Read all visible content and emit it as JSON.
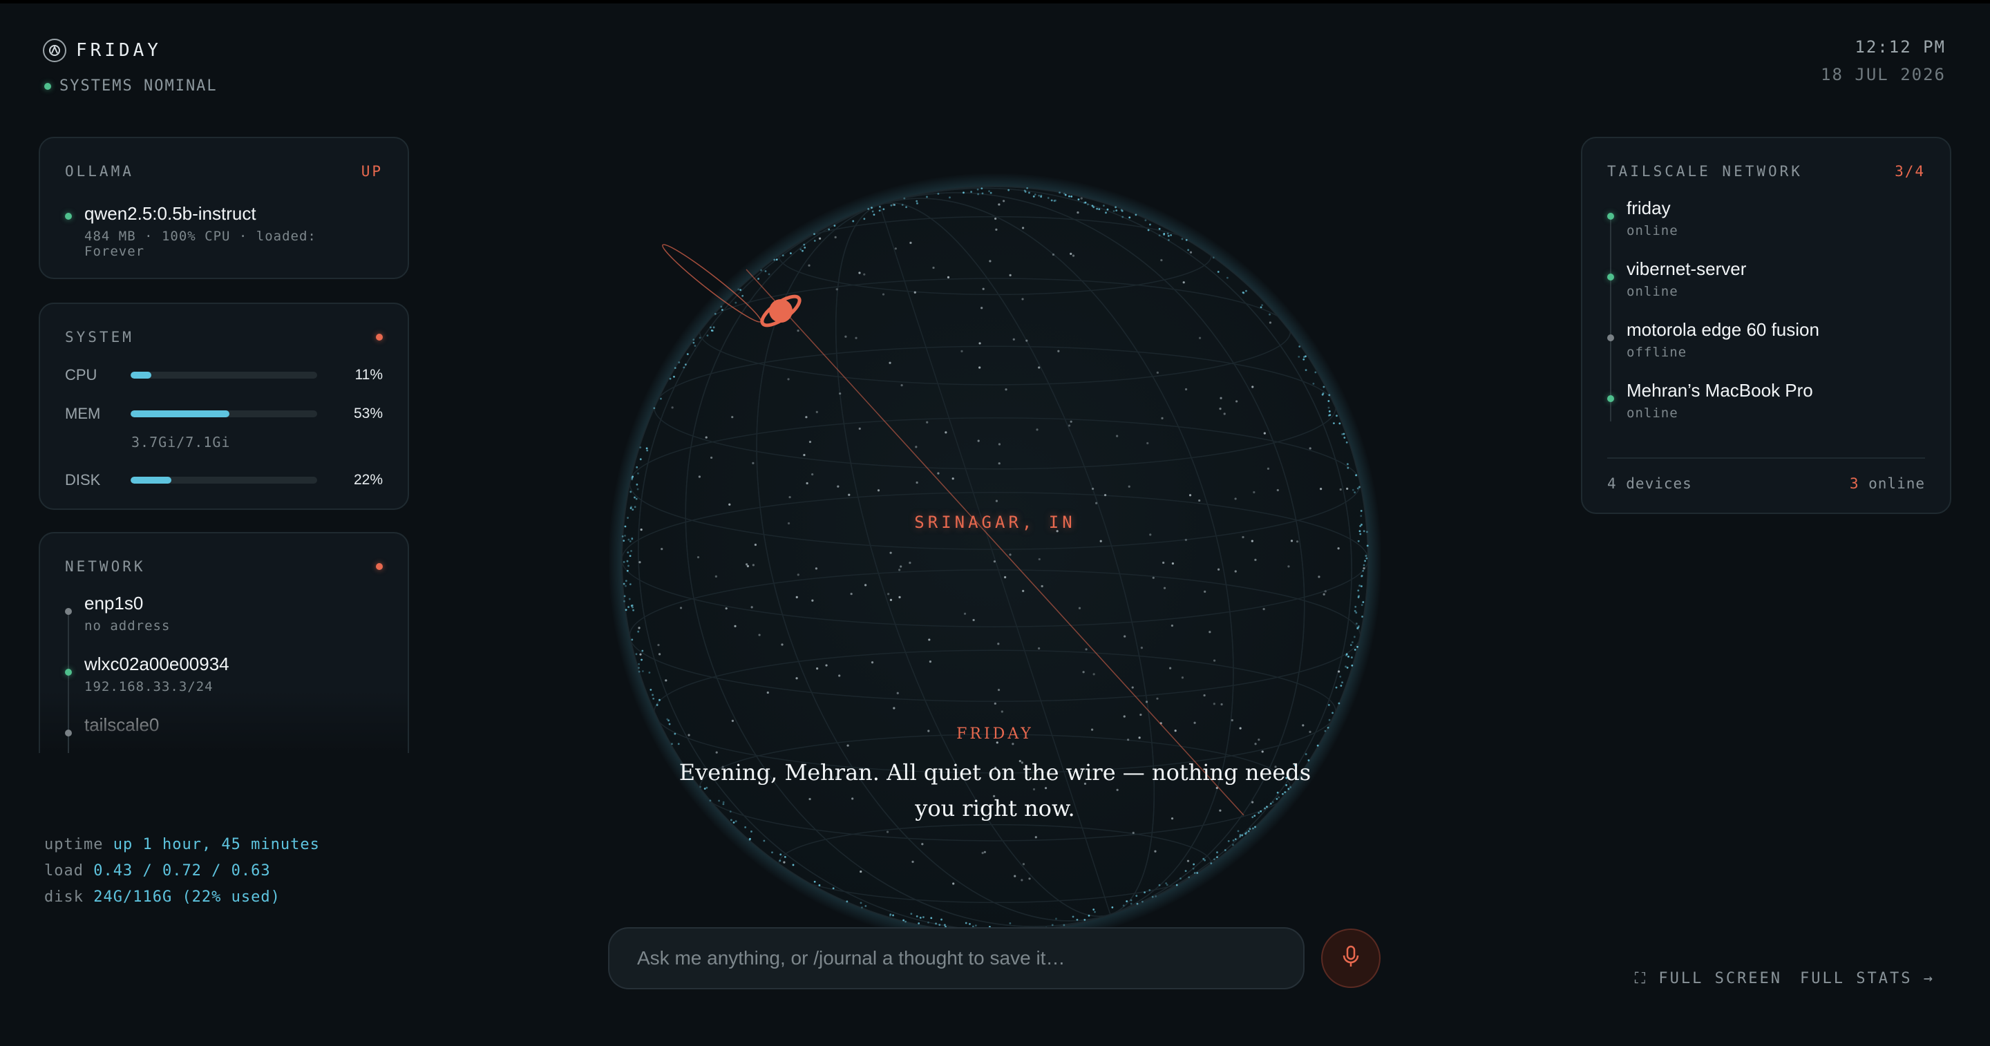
{
  "brand": {
    "name": "FRIDAY",
    "status": "SYSTEMS NOMINAL"
  },
  "clock": {
    "time": "12:12 PM",
    "date": "18 JUL 2026"
  },
  "ollama": {
    "title": "OLLAMA",
    "state": "UP",
    "model": {
      "name": "qwen2.5:0.5b-instruct",
      "details": "484 MB · 100% CPU · loaded: Forever"
    }
  },
  "system": {
    "title": "SYSTEM",
    "meters": [
      {
        "label": "CPU",
        "value": "11%",
        "fraction": 0.11
      },
      {
        "label": "MEM",
        "value": "53%",
        "fraction": 0.53,
        "note": "3.7Gi/7.1Gi"
      },
      {
        "label": "DISK",
        "value": "22%",
        "fraction": 0.22
      }
    ]
  },
  "network": {
    "title": "NETWORK",
    "interfaces": [
      {
        "name": "enp1s0",
        "detail": "no address",
        "status": "down"
      },
      {
        "name": "wlxc02a00e00934",
        "detail": "192.168.33.3/24",
        "status": "up"
      },
      {
        "name": "tailscale0",
        "detail": "",
        "status": "down"
      }
    ]
  },
  "sysinfo": {
    "uptime_label": "uptime",
    "uptime": "up 1 hour, 45 minutes",
    "load_label": "load",
    "load": "0.43 / 0.72 / 0.63",
    "disk_label": "disk",
    "disk": "24G/116G (22% used)"
  },
  "tailscale": {
    "title": "TAILSCALE NETWORK",
    "count": "3/4",
    "devices": [
      {
        "name": "friday",
        "status": "online"
      },
      {
        "name": "vibernet-server",
        "status": "online"
      },
      {
        "name": "motorola edge 60 fusion",
        "status": "offline"
      },
      {
        "name": "Mehran’s MacBook Pro",
        "status": "online"
      }
    ],
    "footer_devices": "4 devices",
    "footer_online_count": "3",
    "footer_online_label": "online"
  },
  "globe": {
    "location": "SRINAGAR, IN"
  },
  "greeting": {
    "label": "FRIDAY",
    "text": "Evening, Mehran. All quiet on the wire — nothing needs you right now."
  },
  "input": {
    "placeholder": "Ask me anything, or /journal a thought to save it…"
  },
  "footer": {
    "fullscreen": "⛶ FULL SCREEN",
    "stats": "FULL STATS →"
  },
  "colors": {
    "accent": "#e8694f",
    "cyan": "#5ec4df",
    "online": "#4fc08d",
    "offline": "#7a8186",
    "background": "#0b1014"
  }
}
